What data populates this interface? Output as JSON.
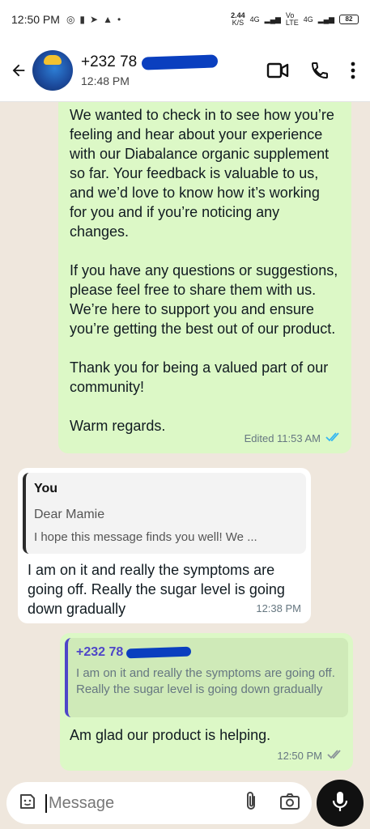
{
  "status_bar": {
    "time": "12:50 PM",
    "network_speed": "2.44",
    "network_unit": "K/S",
    "signal_1": "4G",
    "signal_vo": "Vo",
    "signal_lte": "LTE",
    "signal_2": "4G",
    "battery": "82"
  },
  "header": {
    "contact_prefix": "+232 78",
    "subtitle": "12:48 PM"
  },
  "messages": {
    "m1": {
      "paragraphs": [
        "We wanted to check in to see how you’re feeling and hear about your experience with our Diabalance organic supplement so far. Your feedback is valuable to us, and we’d love to know how it’s working for you and if you’re noticing any changes.",
        "If you have any questions or suggestions, please feel free to share them with us. We’re here to support you and ensure you’re getting the best out of our product.",
        "Thank you for being a valued part of our community!",
        "Warm regards."
      ],
      "meta": "Edited 11:53 AM"
    },
    "m2": {
      "quote_name": "You",
      "quote_line1": "Dear  Mamie",
      "quote_line2": "I hope this message finds you well! We ...",
      "body": "I am on it and really the symptoms are going off.  Really the sugar level is going down gradually",
      "time": "12:38 PM"
    },
    "m3": {
      "quote_name": "+232 78",
      "quote_text": "I am on it and really the symptoms are going off.  Really the sugar level is going down gradually",
      "body": "Am glad our product is helping.",
      "time": "12:50 PM"
    }
  },
  "composer": {
    "placeholder": "Message"
  },
  "colors": {
    "outgoing_bubble": "#dcf8c6",
    "incoming_bubble": "#ffffff",
    "read_ticks": "#34b7f1",
    "quote_accent": "#4e46c8"
  }
}
